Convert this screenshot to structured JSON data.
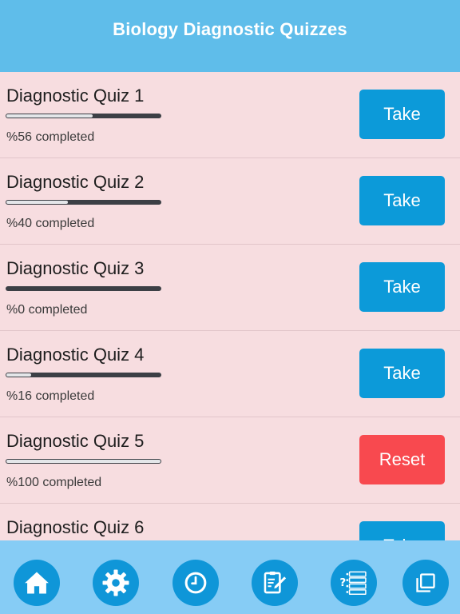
{
  "header": {
    "title": "Biology Diagnostic Quizzes"
  },
  "colors": {
    "header": "#5fbdea",
    "take": "#0c9ad9",
    "reset": "#f8494f",
    "tabbar": "#86ccf5",
    "tab_button": "#0f96d8"
  },
  "quizzes": [
    {
      "title": "Diagnostic Quiz 1",
      "progress": 0.56,
      "status": "%56 completed",
      "button": "Take",
      "action": "take"
    },
    {
      "title": "Diagnostic Quiz 2",
      "progress": 0.4,
      "status": "%40 completed",
      "button": "Take",
      "action": "take"
    },
    {
      "title": "Diagnostic Quiz 3",
      "progress": 0.0,
      "status": "%0 completed",
      "button": "Take",
      "action": "take"
    },
    {
      "title": "Diagnostic Quiz 4",
      "progress": 0.16,
      "status": "%16 completed",
      "button": "Take",
      "action": "take"
    },
    {
      "title": "Diagnostic Quiz 5",
      "progress": 1.0,
      "status": "%100 completed",
      "button": "Reset",
      "action": "reset"
    },
    {
      "title": "Diagnostic Quiz 6",
      "progress": 0.0,
      "status": "",
      "button": "Take",
      "action": "take"
    }
  ],
  "tabbar": {
    "items": [
      {
        "icon": "home-icon"
      },
      {
        "icon": "gear-icon"
      },
      {
        "icon": "clock-icon"
      },
      {
        "icon": "edit-note-icon"
      },
      {
        "icon": "quiz-list-icon"
      },
      {
        "icon": "copy-icon"
      }
    ]
  }
}
